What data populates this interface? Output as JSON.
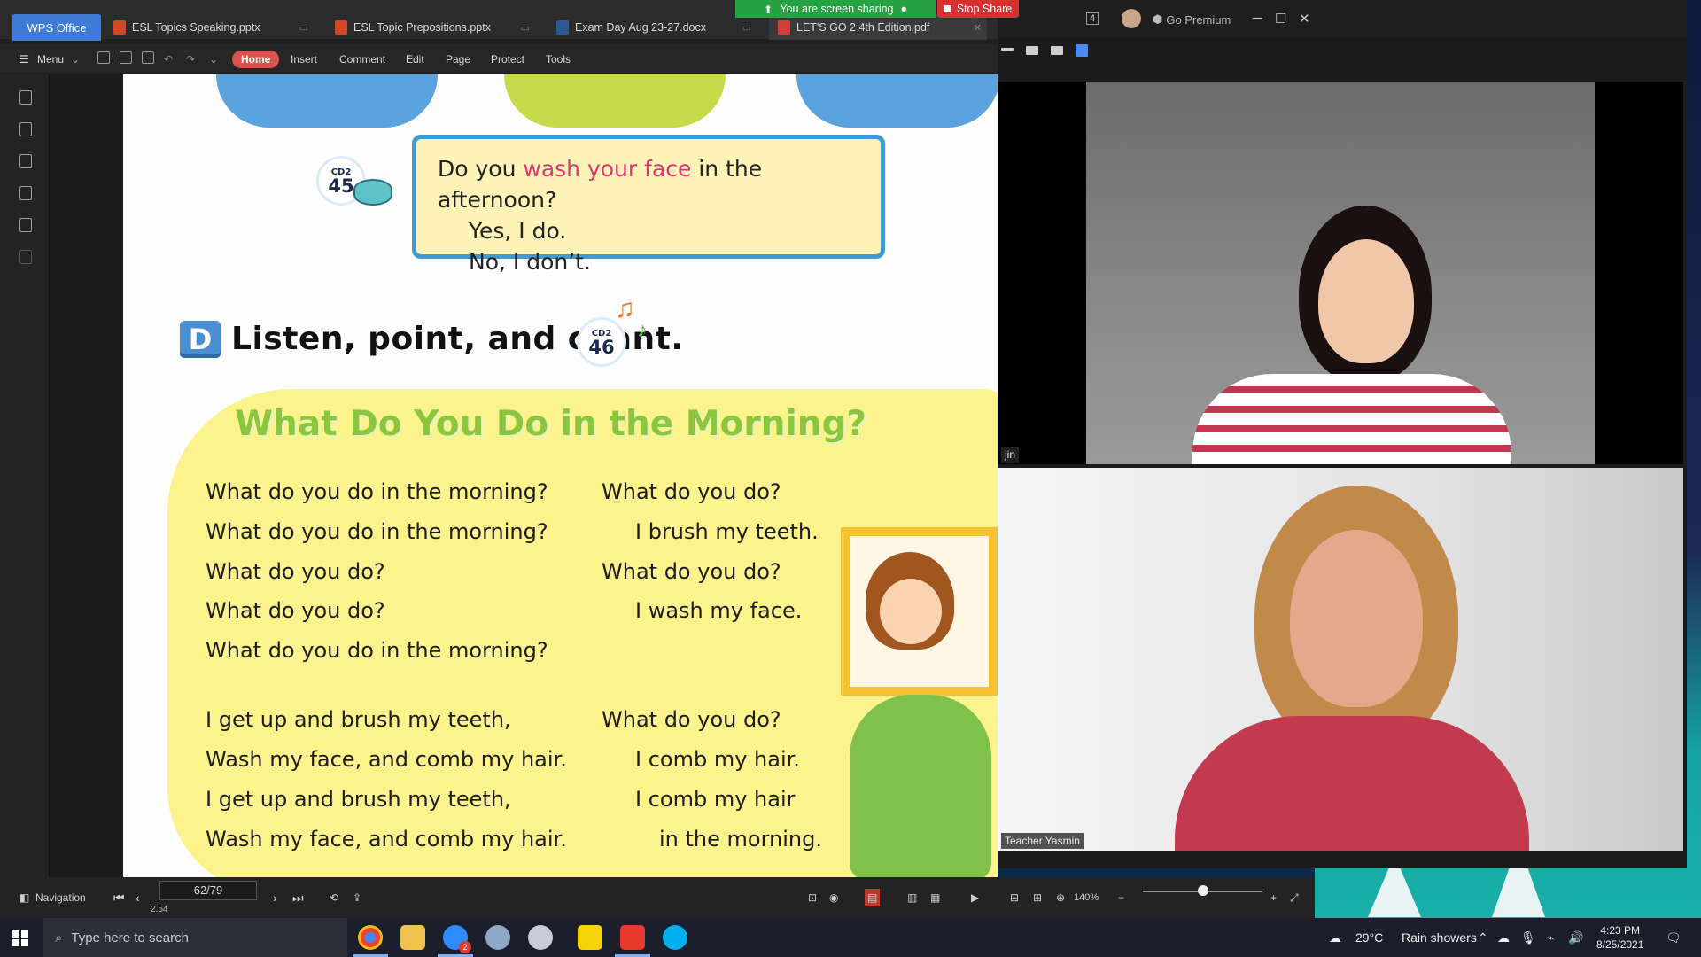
{
  "wps": {
    "app_name": "WPS Office",
    "tabs": [
      {
        "label": "ESL Topics Speaking.pptx",
        "color": "#d24726"
      },
      {
        "label": "ESL Topic Prepositions.pptx",
        "color": "#d24726"
      },
      {
        "label": "Exam Day Aug 23-27.docx",
        "color": "#2b5797"
      },
      {
        "label": "LET'S GO 2 4th Edition.pdf",
        "color": "#d83b3b"
      }
    ],
    "ribbon": {
      "menu": "Menu",
      "items": [
        "Home",
        "Insert",
        "Comment",
        "Edit",
        "Page",
        "Protect",
        "Tools"
      ]
    },
    "status": {
      "navigation": "Navigation",
      "page": "62/79",
      "zoom": "140%",
      "below_page": "2.54"
    }
  },
  "document": {
    "cd_badges": [
      {
        "cd": "CD2",
        "num": "45"
      },
      {
        "cd": "CD2",
        "num": "46"
      }
    ],
    "qa": {
      "question_pre": "Do you ",
      "question_highlight": "wash your face",
      "question_post": " in the afternoon?",
      "answer_yes": "Yes, I do.",
      "answer_no": "No, I don’t."
    },
    "section_letter": "D",
    "section_title": "Listen, point, and chant.",
    "chant_title": "What Do You Do in the Morning?",
    "left_lines": [
      "What do you do in the morning?",
      "What do you do in the morning?",
      "What do you do?",
      "What do you do?",
      "What do you do in the morning?",
      "I get up and brush my teeth,",
      "Wash my face, and comb my hair.",
      "I get up and brush my teeth,",
      "Wash my face, and comb my hair."
    ],
    "right_lines": [
      "What do you do?",
      "I brush my teeth.",
      "What do you do?",
      "I wash my face.",
      "What do you do?",
      "I comb my hair.",
      "I comb my hair",
      "in the morning."
    ]
  },
  "zoom": {
    "go_premium": "Go Premium",
    "sharing_banner": "You are screen sharing",
    "stop_share": "Stop Share",
    "participants": [
      {
        "name": "jin"
      },
      {
        "name": "Teacher Yasmin"
      }
    ]
  },
  "taskbar": {
    "search_placeholder": "Type here to search",
    "weather_temp": "29°C",
    "weather_desc": "Rain showers",
    "time": "4:23 PM",
    "date": "8/25/2021",
    "chrome_badge": "2"
  },
  "colors": {
    "accent_home": "#d9534f",
    "chant_title": "#8cc63f",
    "highlight": "#e0357b",
    "share_green": "#26a243",
    "stop_red": "#d83030"
  }
}
